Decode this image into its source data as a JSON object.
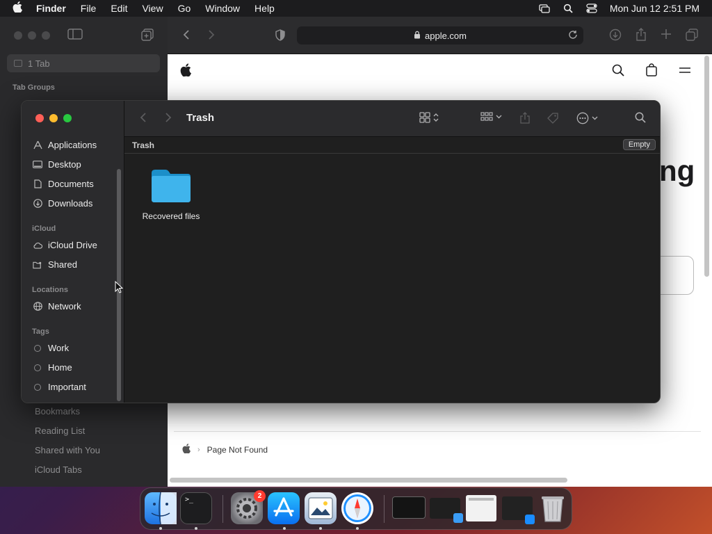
{
  "menubar": {
    "apple_icon": "apple-logo-icon",
    "app_name": "Finder",
    "items": [
      "File",
      "Edit",
      "View",
      "Go",
      "Window",
      "Help"
    ],
    "clock": "Mon Jun 12  2:51 PM"
  },
  "safari": {
    "tab_pill": "1 Tab",
    "tab_groups_title": "Tab Groups",
    "url": "apple.com",
    "sidebar_links": [
      "Bookmarks",
      "Reading List",
      "Shared with You",
      "iCloud Tabs"
    ],
    "page_partial_heading": "ng",
    "breadcrumb_page": "Page Not Found"
  },
  "finder": {
    "window_title": "Trash",
    "path_label": "Trash",
    "empty_button": "Empty",
    "favorites": [
      "Applications",
      "Desktop",
      "Documents",
      "Downloads"
    ],
    "icloud_title": "iCloud",
    "icloud": [
      "iCloud Drive",
      "Shared"
    ],
    "locations_title": "Locations",
    "locations": [
      "Network"
    ],
    "tags_title": "Tags",
    "tags": [
      "Work",
      "Home",
      "Important"
    ],
    "files": [
      {
        "name": "Recovered files",
        "icon": "folder-icon"
      }
    ]
  },
  "dock": {
    "system_settings_badge": "2",
    "apps": [
      "Finder",
      "Terminal",
      "System Settings",
      "App Store",
      "Preview",
      "Safari",
      "Trash"
    ]
  },
  "colors": {
    "folder": "#34aadc",
    "close": "#ff5f57",
    "minimize": "#febc2e",
    "zoom": "#28c840"
  }
}
